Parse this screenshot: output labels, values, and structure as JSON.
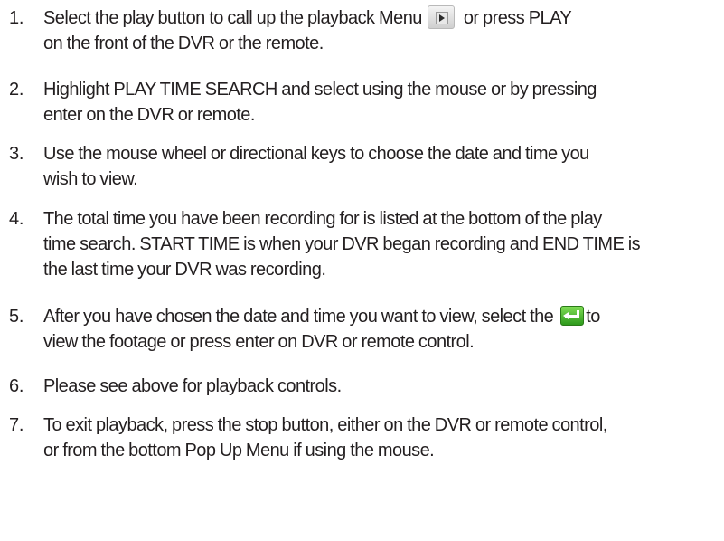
{
  "steps": [
    {
      "number": "1.",
      "lines": [
        {
          "before_icon": "Select the play button to call up the playback Menu",
          "icon": "play-button-icon",
          "after_icon": "or press PLAY"
        },
        {
          "text": "on the front of the DVR or the remote."
        }
      ]
    },
    {
      "number": "2.",
      "lines": [
        {
          "text": "Highlight PLAY TIME SEARCH and select using the mouse or by pressing"
        },
        {
          "text": "enter on the DVR or remote."
        }
      ]
    },
    {
      "number": "3.",
      "lines": [
        {
          "text": "Use the mouse wheel or directional keys to choose the date and time you"
        },
        {
          "text": "wish to view."
        }
      ]
    },
    {
      "number": "4.",
      "lines": [
        {
          "text": "The total time you have been recording for is listed at the bottom of the play"
        },
        {
          "text": "time search. START TIME is when your DVR began recording and END TIME is"
        },
        {
          "text": "the last time your DVR was recording."
        }
      ]
    },
    {
      "number": "5.",
      "lines": [
        {
          "before_icon": "After you have chosen the date and time you want to view, select the",
          "icon": "enter-arrow-icon",
          "after_icon": "to"
        },
        {
          "text": "view the footage or press enter on DVR or remote control."
        }
      ]
    },
    {
      "number": "6.",
      "lines": [
        {
          "text": "Please see above for playback controls."
        }
      ]
    },
    {
      "number": "7.",
      "lines": [
        {
          "text": "To exit playback, press the stop button, either on the DVR or remote control,"
        },
        {
          "text": "or from the bottom Pop Up Menu if using the mouse."
        }
      ]
    }
  ]
}
